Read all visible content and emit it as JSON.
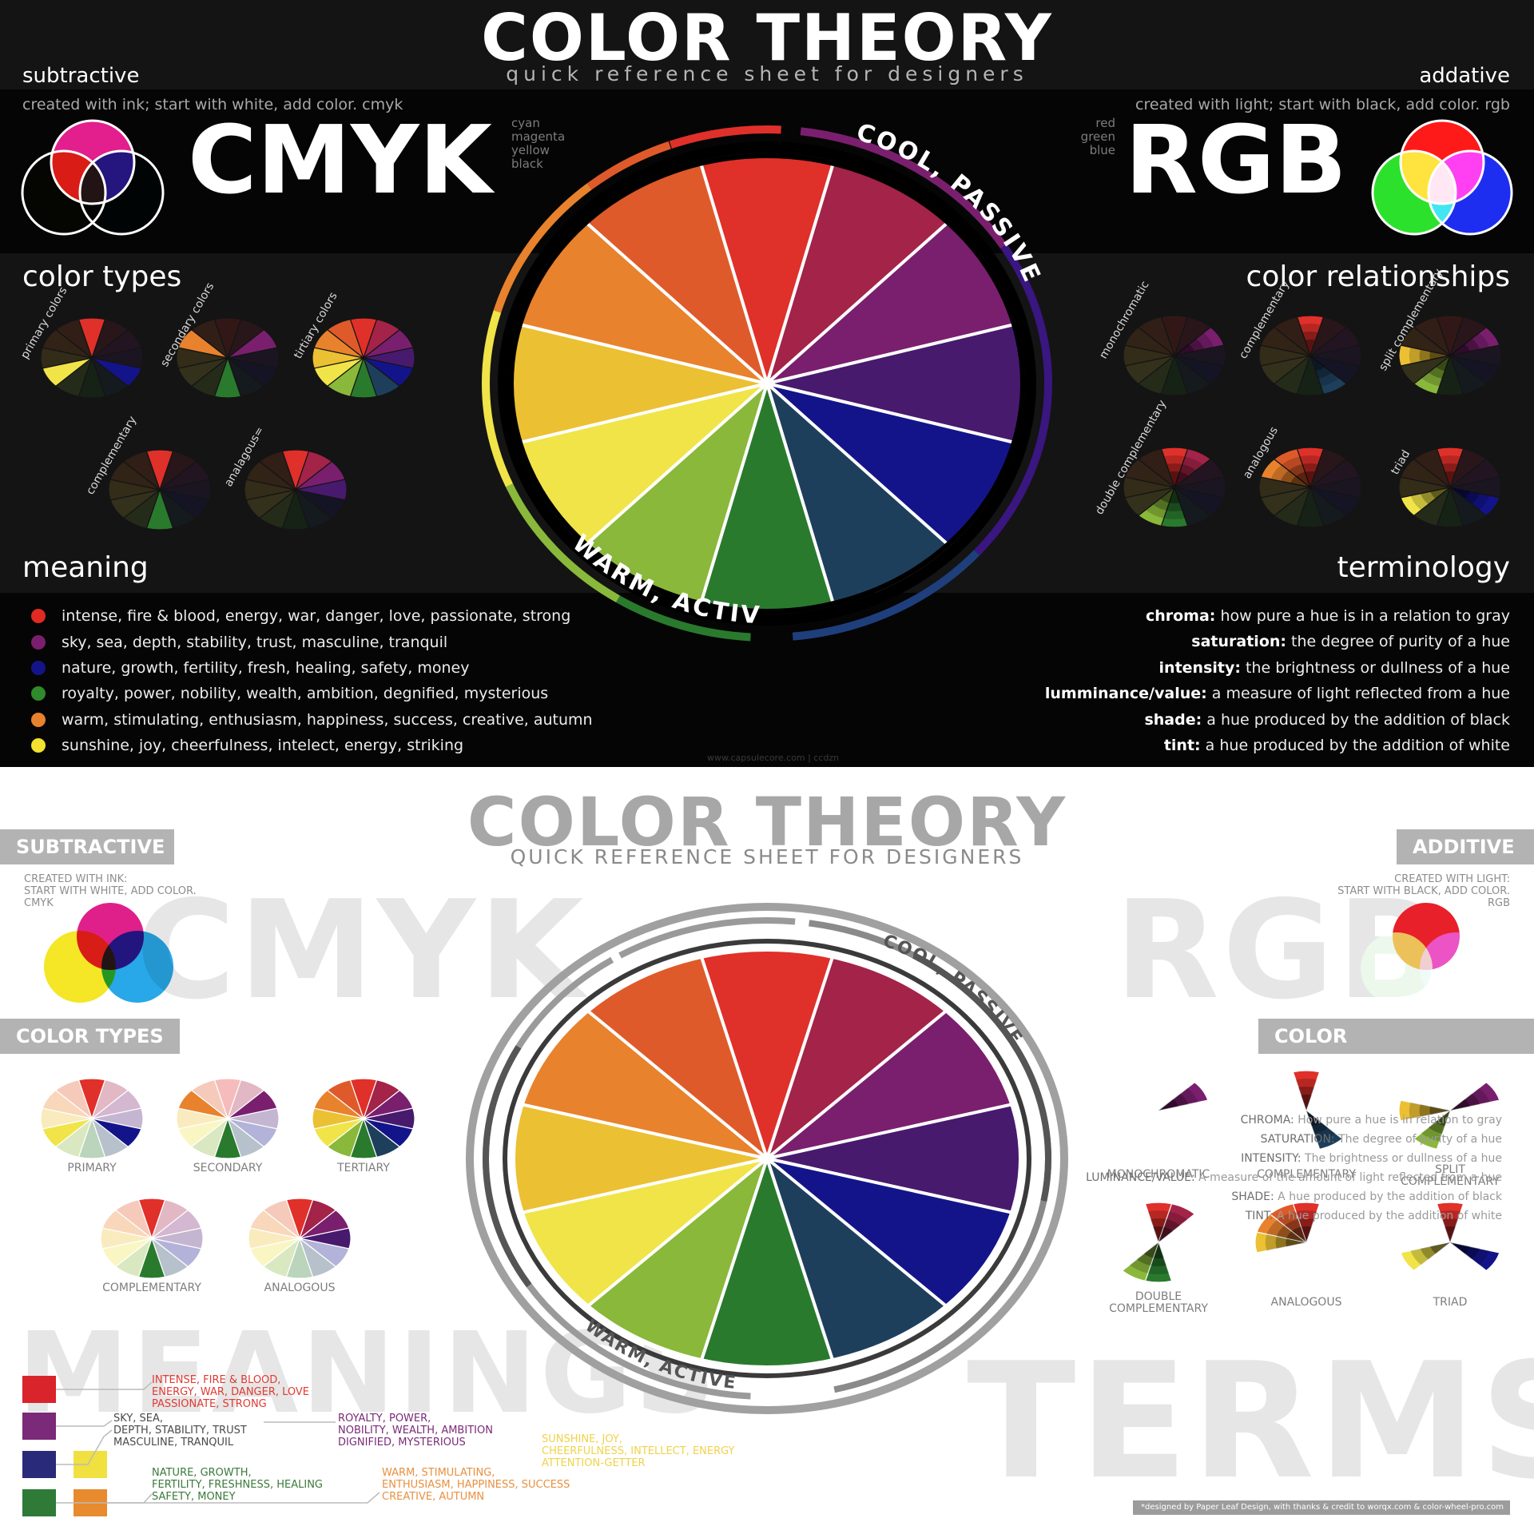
{
  "dark": {
    "title": "COLOR THEORY",
    "subtitle": "quick reference sheet for designers",
    "subtractive": {
      "heading": "subtractive",
      "desc": "created with ink; start with white, add color. cmyk",
      "big": "CMYK",
      "list": [
        "cyan",
        "magenta",
        "yellow",
        "black"
      ]
    },
    "additive": {
      "heading": "addative",
      "desc": "created with light; start with black, add color. rgb",
      "big": "RGB",
      "list": [
        "red",
        "green",
        "blue"
      ]
    },
    "color_types": {
      "heading": "color types",
      "labels": [
        "primary colors",
        "secondary colors",
        "tirtiary colors",
        "complementary",
        "analagous="
      ]
    },
    "color_relationships": {
      "heading": "color relationships",
      "labels": [
        "monochromatic",
        "complementary",
        "split complementary",
        "double complementary",
        "analogous",
        "triad"
      ]
    },
    "wheel": {
      "cool_label": "COOL, PASSIVE",
      "warm_label": "WARM, ACTIVE"
    },
    "meaning": {
      "heading": "meaning",
      "items": [
        {
          "color": "#e02a22",
          "text": "intense, fire & blood, energy, war, danger, love, passionate, strong"
        },
        {
          "color": "#7a1f6e",
          "text": "sky, sea, depth, stability, trust, masculine, tranquil"
        },
        {
          "color": "#14148a",
          "text": "nature, growth, fertility, fresh, healing, safety, money"
        },
        {
          "color": "#2e8a2a",
          "text": "royalty, power, nobility, wealth, ambition, degnified, mysterious"
        },
        {
          "color": "#e8822d",
          "text": "warm, stimulating, enthusiasm, happiness, success, creative, autumn"
        },
        {
          "color": "#f2e12e",
          "text": "sunshine, joy, cheerfulness, intelect, energy, striking"
        }
      ]
    },
    "terminology": {
      "heading": "terminology",
      "items": [
        {
          "term": "chroma:",
          "def": " how pure a hue is in a relation to gray"
        },
        {
          "term": "saturation:",
          "def": " the degree of purity of a hue"
        },
        {
          "term": "intensity:",
          "def": " the brightness or dullness of a hue"
        },
        {
          "term": "lumminance/value:",
          "def": " a measure of light reflected from a hue"
        },
        {
          "term": "shade:",
          "def": " a hue produced by the addition of black"
        },
        {
          "term": "tint:",
          "def": " a hue produced by the addition of white"
        }
      ]
    },
    "credit": "www.capsulecore.com | ccdzn"
  },
  "light": {
    "title": "COLOR THEORY",
    "subtitle": "QUICK REFERENCE SHEET FOR DESIGNERS",
    "subtractive": {
      "ribbon": "SUBTRACTIVE",
      "desc": [
        "CREATED WITH INK:",
        "START WITH WHITE, ADD COLOR.",
        "CMYK"
      ],
      "ghost": "CMYK"
    },
    "additive": {
      "ribbon": "ADDITIVE",
      "desc": [
        "CREATED WITH LIGHT:",
        "START WITH BLACK, ADD COLOR.",
        "RGB"
      ],
      "ghost": "RGB"
    },
    "color_types": {
      "ribbon": "COLOR TYPES",
      "labels": [
        "PRIMARY",
        "SECONDARY",
        "TERTIARY",
        "COMPLEMENTARY",
        "ANALOGOUS"
      ]
    },
    "color_relationships": {
      "ribbon": "COLOR RELATIONSHIPS",
      "labels": [
        "MONOCHROMATIC",
        "COMPLEMENTARY",
        "SPLIT",
        "COMPLEMENTARY",
        "DOUBLE",
        "COMPLEMENTARY",
        "ANALOGOUS",
        "TRIAD"
      ]
    },
    "wheel": {
      "cool_label": "COOL, PASSIVE",
      "warm_label": "WARM, ACTIVE"
    },
    "meanings": {
      "ghost": "MEANINGS",
      "blocks": [
        {
          "color": "#e03a33",
          "lines": [
            "INTENSE, FIRE & BLOOD,",
            "ENERGY, WAR, DANGER, LOVE",
            "PASSIONATE, STRONG"
          ]
        },
        {
          "color": "#4a4a4a",
          "lines": [
            "SKY, SEA,",
            "DEPTH, STABILITY, TRUST",
            "MASCULINE, TRANQUIL"
          ]
        },
        {
          "color": "#7a2a78",
          "lines": [
            "ROYALTY, POWER,",
            "NOBILITY, WEALTH, AMBITION",
            "DIGNIFIED, MYSTERIOUS"
          ]
        },
        {
          "color": "#f0d24a",
          "lines": [
            "SUNSHINE, JOY,",
            "CHEERFULNESS, INTELLECT, ENERGY",
            "ATTENTION-GETTER"
          ]
        },
        {
          "color": "#3a7a3a",
          "lines": [
            "NATURE, GROWTH,",
            "FERTILITY, FRESHNESS, HEALING",
            "SAFETY, MONEY"
          ]
        },
        {
          "color": "#e89040",
          "lines": [
            "WARM, STIMULATING,",
            "ENTHUSIASM, HAPPINESS, SUCCESS",
            "CREATIVE, AUTUMN"
          ]
        }
      ],
      "swatches": [
        "#d8242a",
        "#7a2a78",
        "#2a2a7a",
        "#f0e040",
        "#2e7a36",
        "#e88a2e"
      ]
    },
    "terms": {
      "ghost": "TERMS",
      "items": [
        {
          "term": "CHROMA:",
          "def": " How pure a hue is in relation to gray"
        },
        {
          "term": "SATURATION:",
          "def": " The degree of purity of a hue"
        },
        {
          "term": "INTENSITY:",
          "def": " The brightness or dullness of a hue"
        },
        {
          "term": "LUMINANCE/VALUE:",
          "def": " A measure of the amount of light reflected from a hue"
        },
        {
          "term": "SHADE:",
          "def": " A hue produced by the addition of black"
        },
        {
          "term": "TINT:",
          "def": " A hue produced by the addition of white"
        }
      ]
    },
    "credit": "*designed by Paper Leaf Design, with thanks & credit to worqx.com & color-wheel-pro.com"
  },
  "palette": [
    "#e0302a",
    "#a32349",
    "#7a1f6e",
    "#471a6e",
    "#14148a",
    "#1e3f5c",
    "#2a7a2e",
    "#8ab83a",
    "#f0e449",
    "#ecc033",
    "#e8822d",
    "#df5a2a"
  ],
  "colors": {
    "dark_bg": "#141414",
    "band_bg": "#050505",
    "light_ribbon": "#b3b3b3",
    "ghost_text": "#e6e6e6"
  }
}
